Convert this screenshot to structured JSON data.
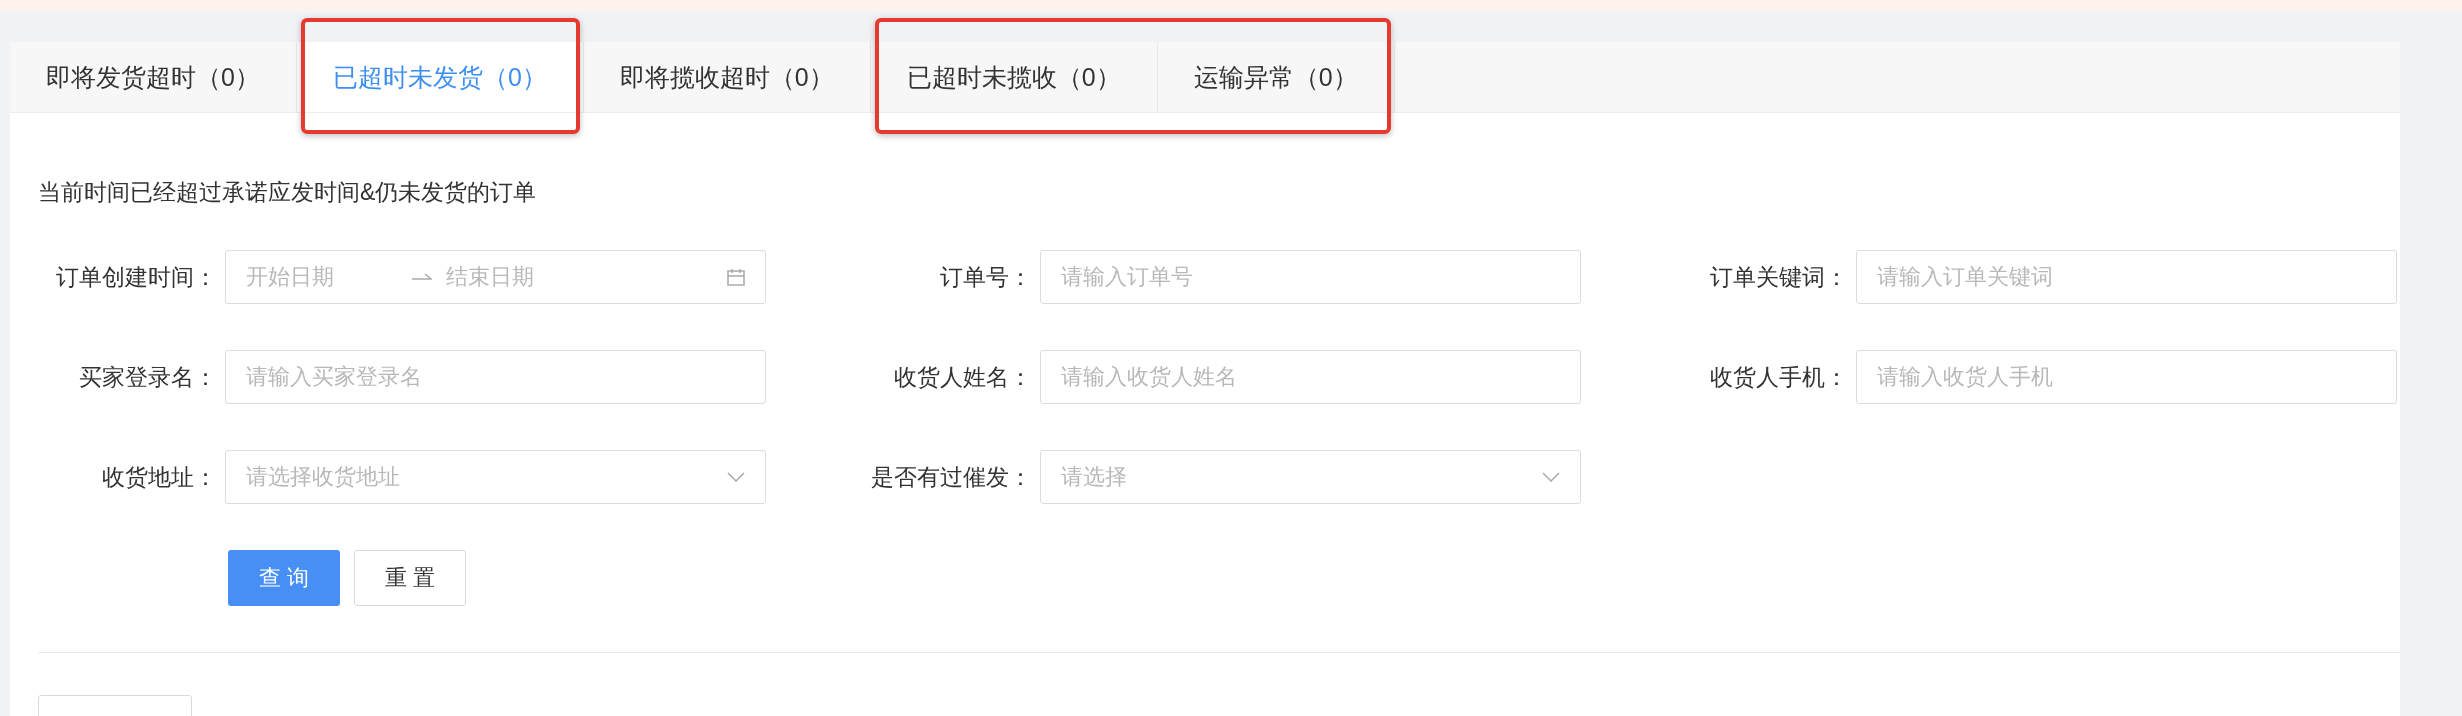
{
  "tabs": [
    {
      "label": "即将发货超时（0）",
      "selected": false,
      "marked": false
    },
    {
      "label": "已超时未发货（0）",
      "selected": true,
      "marked": true
    },
    {
      "label": "即将揽收超时（0）",
      "selected": false,
      "marked": false
    },
    {
      "label": "已超时未揽收（0）",
      "selected": false,
      "marked": true
    },
    {
      "label": "运输异常（0）",
      "selected": false,
      "marked": true
    }
  ],
  "description": "当前时间已经超过承诺应发时间&仍未发货的订单",
  "fields": [
    {
      "label": "订单创建时间：",
      "kind": "date_range",
      "start_placeholder": "开始日期",
      "end_placeholder": "结束日期"
    },
    {
      "label": "订单号：",
      "kind": "text",
      "placeholder": "请输入订单号"
    },
    {
      "label": "订单关键词：",
      "kind": "text",
      "placeholder": "请输入订单关键词"
    },
    {
      "label": "买家登录名：",
      "kind": "text",
      "placeholder": "请输入买家登录名"
    },
    {
      "label": "收货人姓名：",
      "kind": "text",
      "placeholder": "请输入收货人姓名"
    },
    {
      "label": "收货人手机：",
      "kind": "text",
      "placeholder": "请输入收货人手机"
    },
    {
      "label": "收货地址：",
      "kind": "select",
      "placeholder": "请选择收货地址"
    },
    {
      "label": "是否有过催发：",
      "kind": "select",
      "placeholder": "请选择"
    }
  ],
  "buttons": [
    {
      "label": "查 询",
      "kind": "primary"
    },
    {
      "label": "重 置",
      "kind": "default"
    }
  ]
}
